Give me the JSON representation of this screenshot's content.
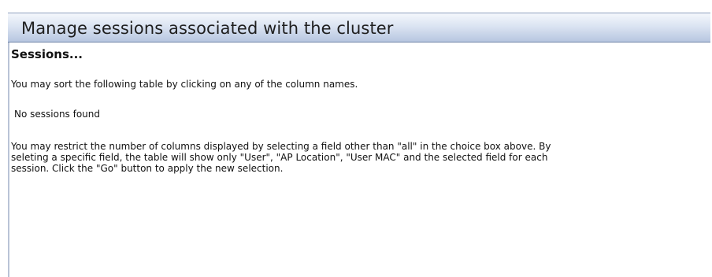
{
  "header": {
    "title": "Manage sessions associated with the cluster"
  },
  "main": {
    "section_title": "Sessions...",
    "sort_note": "You may sort the following table by clicking on any of the column names.",
    "empty_message": "No sessions found",
    "restrict_note_lines": [
      "You may restrict the number of columns displayed by selecting a field other than \"all\" in the choice box above.   By",
      "seleting a specific field, the table will show only \"User\", \"AP Location\", \"User MAC\" and the selected field for each",
      "session.  Click the \"Go\" button to apply the new selection."
    ]
  }
}
